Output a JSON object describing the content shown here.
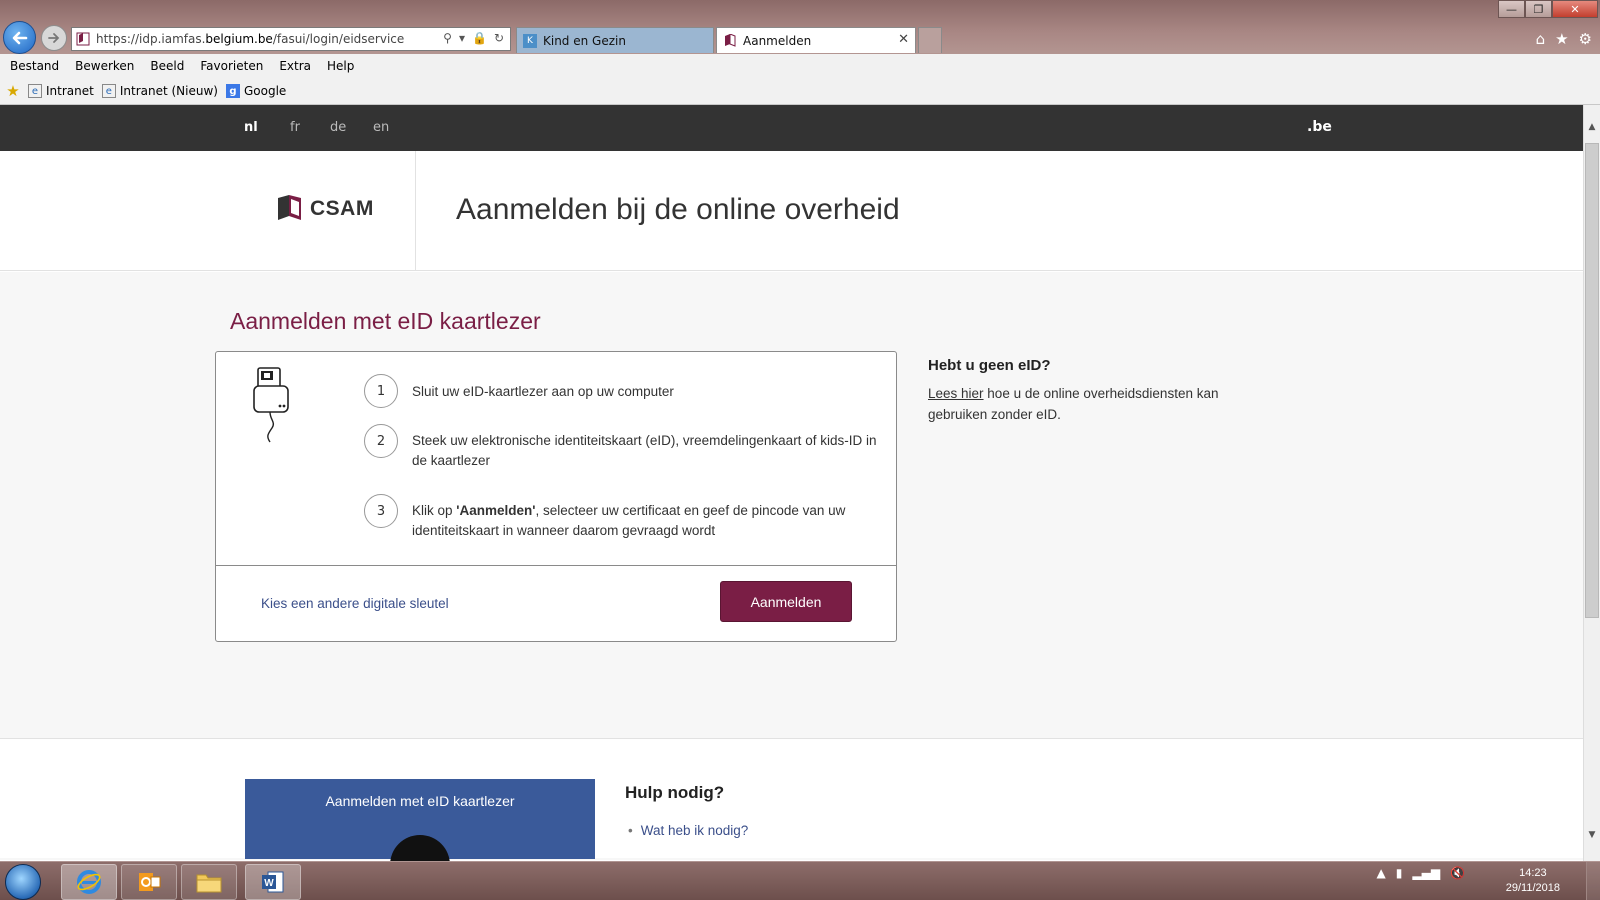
{
  "browser": {
    "url_prefix": "https://idp.iamfas.",
    "url_domain": "belgium.be",
    "url_path": "/fasui/login/eidservice",
    "tabs": [
      {
        "label": "Kind en Gezin"
      },
      {
        "label": "Aanmelden"
      }
    ],
    "menu": [
      "Bestand",
      "Bewerken",
      "Beeld",
      "Favorieten",
      "Extra",
      "Help"
    ],
    "favorites": [
      "Intranet",
      "Intranet (Nieuw)",
      "Google"
    ]
  },
  "topbar": {
    "languages": [
      "nl",
      "fr",
      "de",
      "en"
    ],
    "active_language": "nl",
    "be_logo": ".be"
  },
  "header": {
    "logo_text": "CSAM",
    "title": "Aanmelden bij de online overheid"
  },
  "main": {
    "section_title": "Aanmelden met eID kaartlezer",
    "steps": [
      {
        "number": "1",
        "text_before": "Sluit uw eID-kaartlezer aan op uw computer",
        "bold": "",
        "text_after": ""
      },
      {
        "number": "2",
        "text_before": "Steek uw elektronische identiteitskaart (eID), vreemdelingenkaart of kids-ID in de kaartlezer",
        "bold": "",
        "text_after": ""
      },
      {
        "number": "3",
        "text_before": "Klik op ",
        "bold": "'Aanmelden'",
        "text_after": ", selecteer uw certificaat en geef de pincode van uw identiteitskaart in wanneer daarom gevraagd wordt"
      }
    ],
    "other_key_link": "Kies een andere digitale sleutel",
    "login_button": "Aanmelden"
  },
  "sidebar": {
    "title": "Hebt u geen eID?",
    "link": "Lees hier",
    "text": " hoe u de online overheidsdiensten kan gebruiken zonder eID."
  },
  "help": {
    "video_title": "Aanmelden met eID kaartlezer",
    "title": "Hulp nodig?",
    "links": [
      "Wat heb ik nodig?"
    ]
  },
  "taskbar": {
    "time": "14:23",
    "date": "29/11/2018"
  },
  "colors": {
    "brand_purple": "#7a1e45",
    "topbar_dark": "#333333",
    "link_blue": "#3b4f8a"
  }
}
